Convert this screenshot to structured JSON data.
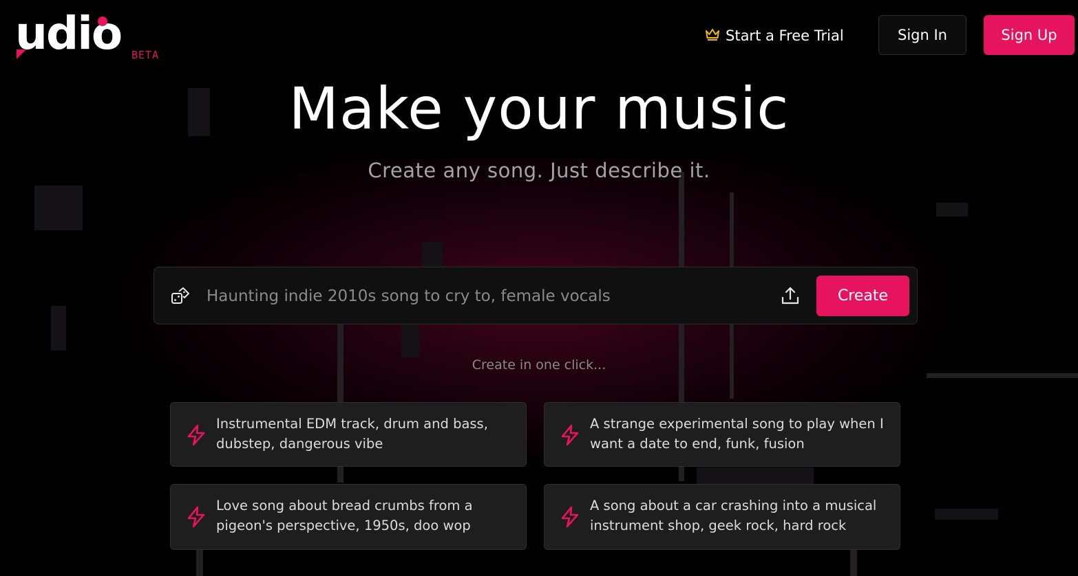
{
  "brand": {
    "name": "udio",
    "badge": "BETA",
    "accent": "#e6135e"
  },
  "header": {
    "trial_label": "Start a Free Trial",
    "trial_icon": "crown-icon",
    "signin_label": "Sign In",
    "signup_label": "Sign Up"
  },
  "hero": {
    "title": "Make your music",
    "subtitle": "Create any song. Just describe it."
  },
  "prompt": {
    "placeholder": "Haunting indie 2010s song to cry to, female vocals",
    "value": "",
    "random_icon": "dice-icon",
    "upload_icon": "upload-icon",
    "create_label": "Create"
  },
  "quick": {
    "heading": "Create in one click...",
    "icon": "lightning-icon",
    "items": [
      {
        "text": "Instrumental EDM track, drum and bass, dubstep, dangerous vibe"
      },
      {
        "text": "A strange experimental song to play when I want a date to end, funk, fusion"
      },
      {
        "text": "Love song about bread crumbs from a pigeon's perspective, 1950s, doo wop"
      },
      {
        "text": "A song about a car crashing into a musical instrument shop, geek rock, hard rock"
      }
    ]
  }
}
